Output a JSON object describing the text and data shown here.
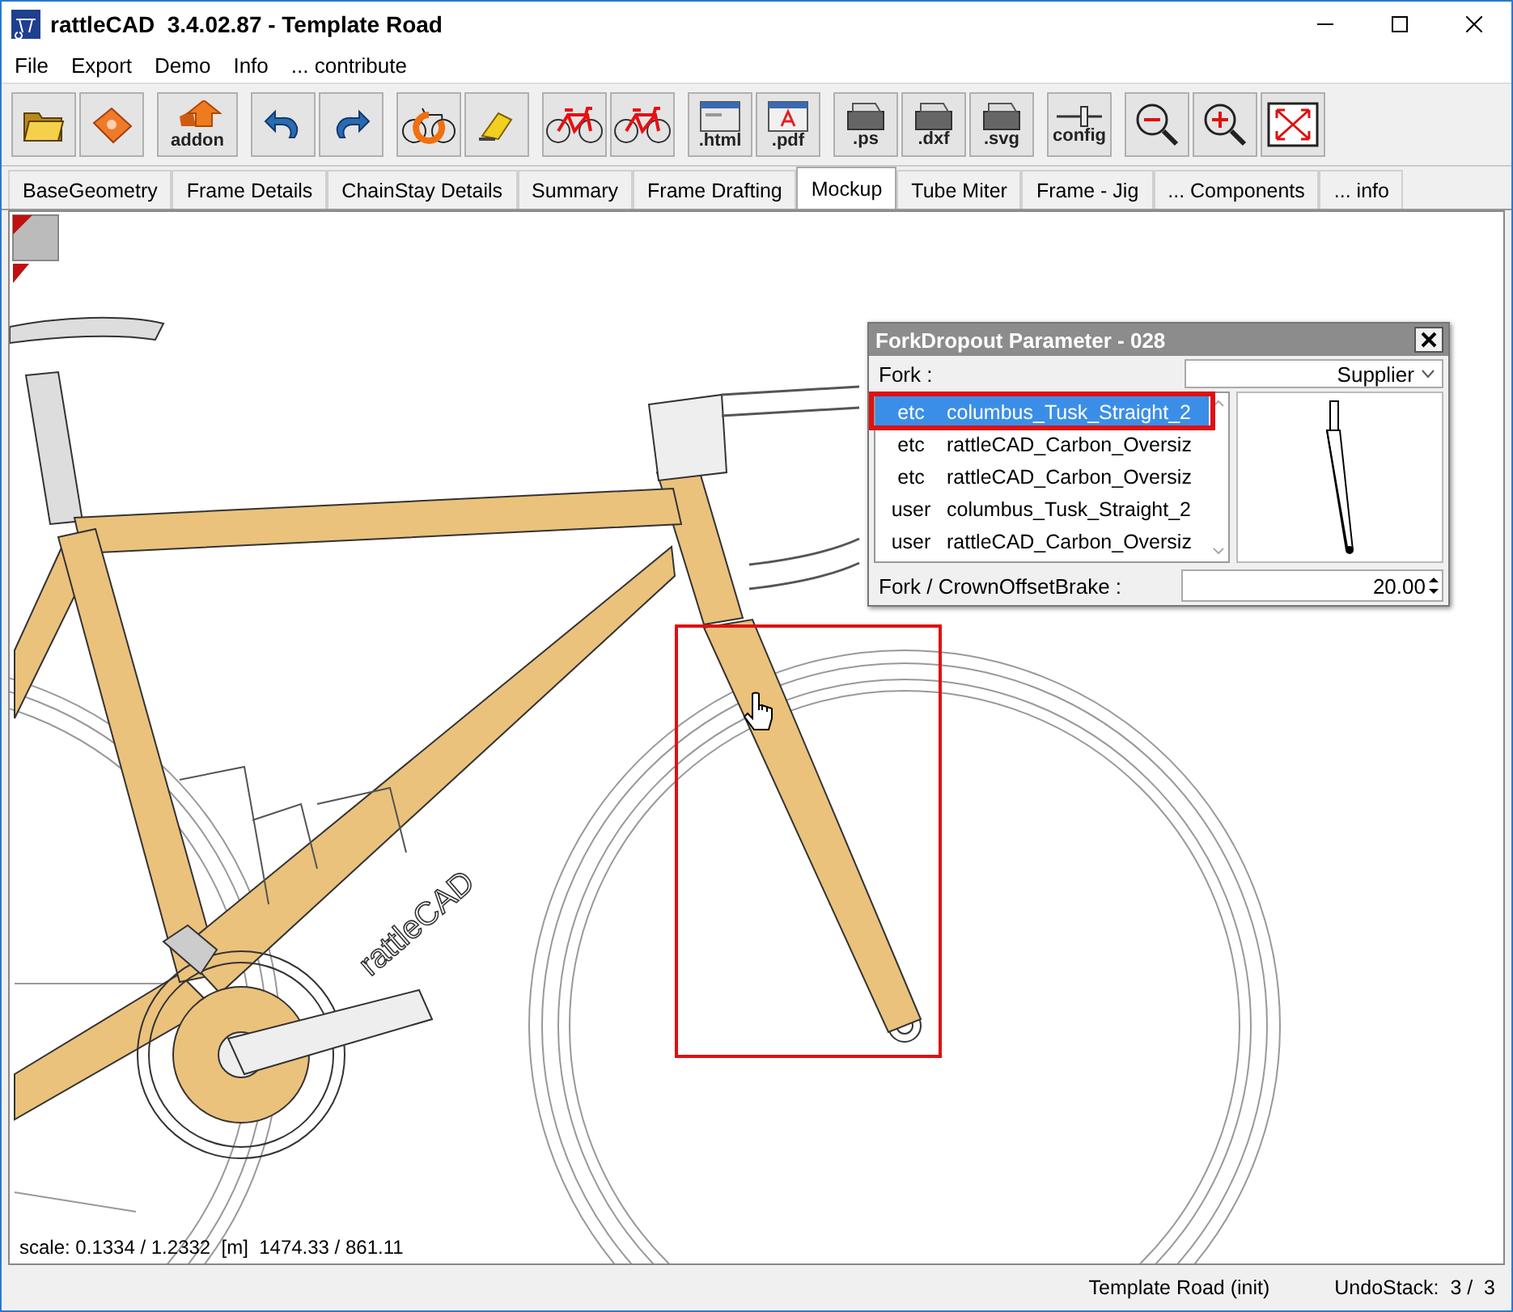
{
  "window": {
    "title": "rattleCAD  3.4.02.87 - Template Road"
  },
  "menu": [
    "File",
    "Export",
    "Demo",
    "Info",
    "... contribute"
  ],
  "toolbar": [
    {
      "buttons": [
        {
          "kind": "open"
        },
        {
          "kind": "save"
        }
      ]
    },
    {
      "buttons": [
        {
          "kind": "addon",
          "label": "addon"
        }
      ]
    },
    {
      "buttons": [
        {
          "kind": "undo"
        },
        {
          "kind": "redo"
        }
      ]
    },
    {
      "buttons": [
        {
          "kind": "update"
        },
        {
          "kind": "eraser"
        }
      ]
    },
    {
      "buttons": [
        {
          "kind": "bike"
        },
        {
          "kind": "bike"
        }
      ]
    },
    {
      "buttons": [
        {
          "kind": "html",
          "label": ".html"
        },
        {
          "kind": "pdf",
          "label": ".pdf"
        }
      ]
    },
    {
      "buttons": [
        {
          "kind": "printer",
          "label": ".ps"
        },
        {
          "kind": "printer",
          "label": ".dxf"
        },
        {
          "kind": "printer",
          "label": ".svg"
        }
      ]
    },
    {
      "buttons": [
        {
          "kind": "config",
          "label": "config"
        }
      ]
    },
    {
      "buttons": [
        {
          "kind": "zoom_out"
        },
        {
          "kind": "zoom_in"
        },
        {
          "kind": "fit"
        }
      ]
    }
  ],
  "tabs": [
    {
      "label": "BaseGeometry",
      "selected": false
    },
    {
      "label": "Frame Details",
      "selected": false
    },
    {
      "label": "ChainStay Details",
      "selected": false
    },
    {
      "label": "Summary",
      "selected": false
    },
    {
      "label": "Frame Drafting",
      "selected": false
    },
    {
      "label": "Mockup",
      "selected": true
    },
    {
      "label": "Tube Miter",
      "selected": false
    },
    {
      "label": "Frame - Jig",
      "selected": false
    },
    {
      "label": "... Components",
      "selected": false
    },
    {
      "label": "... info",
      "selected": false
    }
  ],
  "canvas": {
    "frame_logo": "rattleCAD",
    "scale_readout": "scale: 0.1334 / 1.2332  [m]  1474.33 / 861.11"
  },
  "dialog": {
    "title": "ForkDropout Parameter - 028",
    "fork_label": "Fork :",
    "dropdown": "Supplier",
    "rows": [
      {
        "source": "etc",
        "name": "columbus_Tusk_Straight_2",
        "selected": true
      },
      {
        "source": "etc",
        "name": "rattleCAD_Carbon_Oversiz",
        "selected": false
      },
      {
        "source": "etc",
        "name": "rattleCAD_Carbon_Oversiz",
        "selected": false
      },
      {
        "source": "user",
        "name": "columbus_Tusk_Straight_2",
        "selected": false
      },
      {
        "source": "user",
        "name": "rattleCAD_Carbon_Oversiz",
        "selected": false
      }
    ],
    "offset_label": "Fork / CrownOffsetBrake :",
    "offset_value": "20.00"
  },
  "status_bar": {
    "document": "Template Road (init)",
    "undo": "UndoStack:  3 /  3"
  }
}
